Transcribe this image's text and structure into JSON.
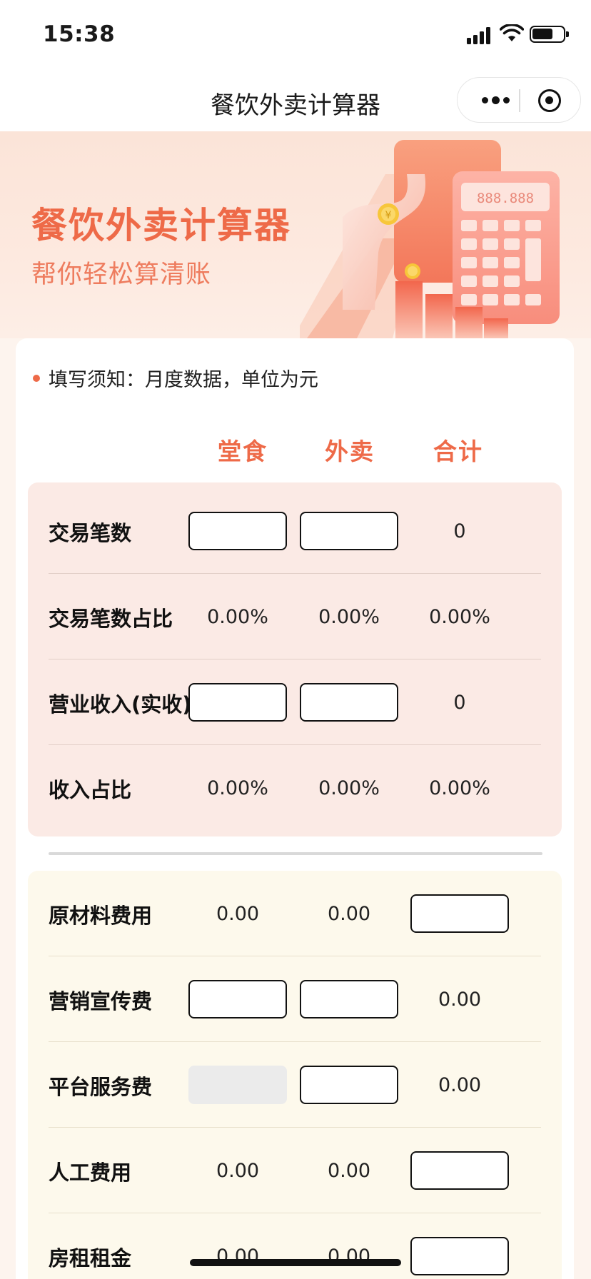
{
  "status": {
    "time": "15:38"
  },
  "nav": {
    "title": "餐饮外卖计算器"
  },
  "banner": {
    "title": "餐饮外卖计算器",
    "subtitle": "帮你轻松算清账",
    "calc_display": "888.888",
    "coin_symbol": "¥"
  },
  "card": {
    "notice": "填写须知：月度数据，单位为元",
    "columns": [
      "堂食",
      "外卖",
      "合计"
    ],
    "section1": [
      {
        "label": "交易笔数",
        "dine": null,
        "takeout": null,
        "total": "0"
      },
      {
        "label": "交易笔数占比",
        "dine": "0.00%",
        "takeout": "0.00%",
        "total": "0.00%"
      },
      {
        "label": "营业收入(实收)",
        "dine": null,
        "takeout": null,
        "total": "0"
      },
      {
        "label": "收入占比",
        "dine": "0.00%",
        "takeout": "0.00%",
        "total": "0.00%"
      }
    ],
    "section2": [
      {
        "label": "原材料费用",
        "dine": "0.00",
        "takeout": "0.00",
        "total": null
      },
      {
        "label": "营销宣传费",
        "dine": null,
        "takeout": null,
        "total": "0.00"
      },
      {
        "label": "平台服务费",
        "dine": "disabled",
        "takeout": null,
        "total": "0.00"
      },
      {
        "label": "人工费用",
        "dine": "0.00",
        "takeout": "0.00",
        "total": null
      },
      {
        "label": "房租租金",
        "dine": "0.00",
        "takeout": "0.00",
        "total": null
      }
    ]
  },
  "colors": {
    "accent": "#ee6a48",
    "section1_bg": "#fbeae5",
    "section2_bg": "#fdf9ec"
  }
}
